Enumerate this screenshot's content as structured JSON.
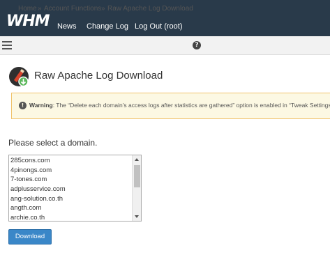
{
  "header": {
    "logo": "WHM",
    "nav": [
      "News",
      "Change Log",
      "Log Out (root)"
    ]
  },
  "breadcrumb": {
    "items": [
      "Home",
      "Account Functions",
      "Raw Apache Log Download"
    ],
    "separator": "»"
  },
  "page": {
    "title": "Raw Apache Log Download"
  },
  "warning": {
    "label": "Warning",
    "text": ": The “Delete each domain’s access logs after statistics are gathered” option is enabled in “Tweak Settings"
  },
  "form": {
    "label": "Please select a domain.",
    "domains": [
      "285cons.com",
      "4pinongs.com",
      "7-tones.com",
      "adplusservice.com",
      "ang-solution.co.th",
      "angth.com",
      "archie.co.th"
    ],
    "button": "Download"
  },
  "colors": {
    "topbar": "#293a4a",
    "accent": "#3a87c8",
    "warning_bg": "#fcf8e3",
    "warning_border": "#f0c36d"
  },
  "icons": {
    "menu": "hamburger-menu-icon",
    "help": "help-icon",
    "page": "raw-log-download-icon",
    "warning": "exclamation-icon"
  }
}
